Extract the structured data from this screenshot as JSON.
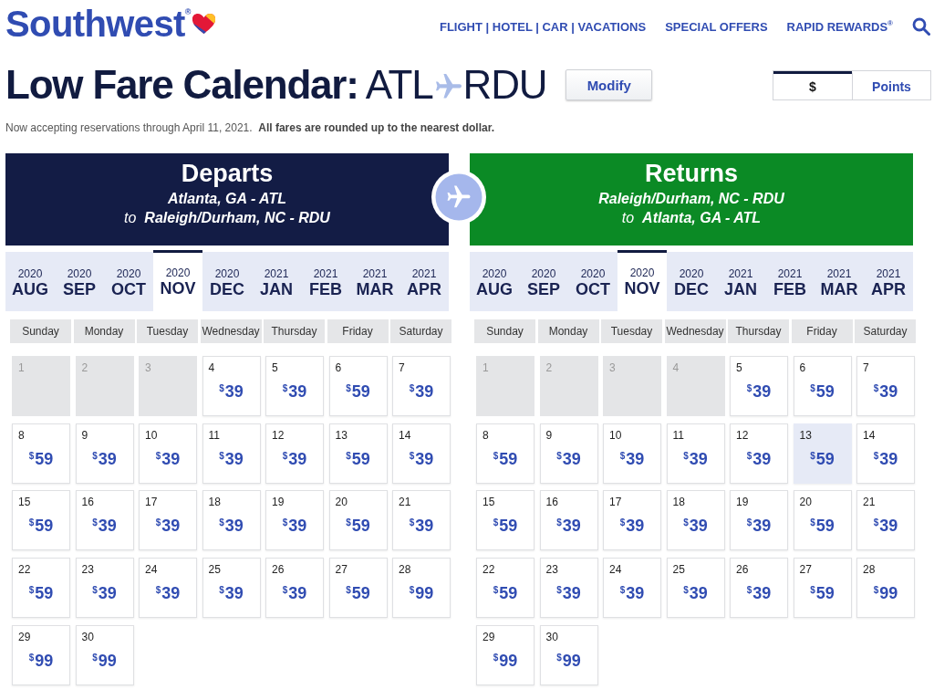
{
  "header": {
    "logo": "Southwest$^{®}$",
    "nav_links": [
      "FLIGHT | HOTEL | CAR | VACATIONS",
      "SPECIAL OFFERS",
      "RAPID REWARDS$^{®}$"
    ]
  },
  "title": {
    "label": "Low Fare Calendar:",
    "origin": "ATL",
    "destination": "RDU"
  },
  "modify_button": "Modify",
  "currency_toggle": [
    {
      "label": "$",
      "selected": true
    },
    {
      "label": "Points",
      "selected": false
    }
  ],
  "note": "Now accepting reservations through April 11, 2021.  **All fares are rounded up to the nearest dollar.**",
  "calendars": [
    {
      "title": "Departs",
      "color": "#131c45",
      "route_from": "Atlanta, GA - ATL",
      "route_to": "to  **Raleigh/Durham, NC - RDU**",
      "months": [
        {
          "year": "2020",
          "month": "AUG",
          "selected": false
        },
        {
          "year": "2020",
          "month": "SEP",
          "selected": false
        },
        {
          "year": "2020",
          "month": "OCT",
          "selected": false
        },
        {
          "year": "2020",
          "month": "NOV",
          "selected": true
        },
        {
          "year": "2020",
          "month": "DEC",
          "selected": false
        },
        {
          "year": "2021",
          "month": "JAN",
          "selected": false
        },
        {
          "year": "2021",
          "month": "FEB",
          "selected": false
        },
        {
          "year": "2021",
          "month": "MAR",
          "selected": false
        },
        {
          "year": "2021",
          "month": "APR",
          "selected": false
        }
      ],
      "weekdays": [
        "Sunday",
        "Monday",
        "Tuesday",
        "Wednesday",
        "Thursday",
        "Friday",
        "Saturday"
      ],
      "days": [
        {
          "day": "1",
          "disabled": true,
          "selected": false
        },
        {
          "day": "2",
          "disabled": true,
          "selected": false
        },
        {
          "day": "3",
          "disabled": true,
          "selected": false
        },
        {
          "day": "4",
          "disabled": false,
          "selected": false,
          "currency": "$",
          "fare": "39"
        },
        {
          "day": "5",
          "disabled": false,
          "selected": false,
          "currency": "$",
          "fare": "39"
        },
        {
          "day": "6",
          "disabled": false,
          "selected": false,
          "currency": "$",
          "fare": "59"
        },
        {
          "day": "7",
          "disabled": false,
          "selected": false,
          "currency": "$",
          "fare": "39"
        },
        {
          "day": "8",
          "disabled": false,
          "selected": false,
          "currency": "$",
          "fare": "59"
        },
        {
          "day": "9",
          "disabled": false,
          "selected": false,
          "currency": "$",
          "fare": "39"
        },
        {
          "day": "10",
          "disabled": false,
          "selected": false,
          "currency": "$",
          "fare": "39"
        },
        {
          "day": "11",
          "disabled": false,
          "selected": false,
          "currency": "$",
          "fare": "39"
        },
        {
          "day": "12",
          "disabled": false,
          "selected": false,
          "currency": "$",
          "fare": "39"
        },
        {
          "day": "13",
          "disabled": false,
          "selected": false,
          "currency": "$",
          "fare": "59"
        },
        {
          "day": "14",
          "disabled": false,
          "selected": false,
          "currency": "$",
          "fare": "39"
        },
        {
          "day": "15",
          "disabled": false,
          "selected": false,
          "currency": "$",
          "fare": "59"
        },
        {
          "day": "16",
          "disabled": false,
          "selected": false,
          "currency": "$",
          "fare": "39"
        },
        {
          "day": "17",
          "disabled": false,
          "selected": false,
          "currency": "$",
          "fare": "39"
        },
        {
          "day": "18",
          "disabled": false,
          "selected": false,
          "currency": "$",
          "fare": "39"
        },
        {
          "day": "19",
          "disabled": false,
          "selected": false,
          "currency": "$",
          "fare": "39"
        },
        {
          "day": "20",
          "disabled": false,
          "selected": false,
          "currency": "$",
          "fare": "59"
        },
        {
          "day": "21",
          "disabled": false,
          "selected": false,
          "currency": "$",
          "fare": "39"
        },
        {
          "day": "22",
          "disabled": false,
          "selected": false,
          "currency": "$",
          "fare": "59"
        },
        {
          "day": "23",
          "disabled": false,
          "selected": false,
          "currency": "$",
          "fare": "39"
        },
        {
          "day": "24",
          "disabled": false,
          "selected": false,
          "currency": "$",
          "fare": "39"
        },
        {
          "day": "25",
          "disabled": false,
          "selected": false,
          "currency": "$",
          "fare": "39"
        },
        {
          "day": "26",
          "disabled": false,
          "selected": false,
          "currency": "$",
          "fare": "39"
        },
        {
          "day": "27",
          "disabled": false,
          "selected": false,
          "currency": "$",
          "fare": "59"
        },
        {
          "day": "28",
          "disabled": false,
          "selected": false,
          "currency": "$",
          "fare": "99"
        },
        {
          "day": "29",
          "disabled": false,
          "selected": false,
          "currency": "$",
          "fare": "99"
        },
        {
          "day": "30",
          "disabled": false,
          "selected": false,
          "currency": "$",
          "fare": "99"
        }
      ]
    },
    {
      "title": "Returns",
      "color": "#0b8a25",
      "route_from": "Raleigh/Durham, NC - RDU",
      "route_to": "to  **Atlanta, GA - ATL**",
      "months": [
        {
          "year": "2020",
          "month": "AUG",
          "selected": false
        },
        {
          "year": "2020",
          "month": "SEP",
          "selected": false
        },
        {
          "year": "2020",
          "month": "OCT",
          "selected": false
        },
        {
          "year": "2020",
          "month": "NOV",
          "selected": true
        },
        {
          "year": "2020",
          "month": "DEC",
          "selected": false
        },
        {
          "year": "2021",
          "month": "JAN",
          "selected": false
        },
        {
          "year": "2021",
          "month": "FEB",
          "selected": false
        },
        {
          "year": "2021",
          "month": "MAR",
          "selected": false
        },
        {
          "year": "2021",
          "month": "APR",
          "selected": false
        }
      ],
      "weekdays": [
        "Sunday",
        "Monday",
        "Tuesday",
        "Wednesday",
        "Thursday",
        "Friday",
        "Saturday"
      ],
      "days": [
        {
          "day": "1",
          "disabled": true,
          "selected": false
        },
        {
          "day": "2",
          "disabled": true,
          "selected": false
        },
        {
          "day": "3",
          "disabled": true,
          "selected": false
        },
        {
          "day": "4",
          "disabled": true,
          "selected": false
        },
        {
          "day": "5",
          "disabled": false,
          "selected": false,
          "currency": "$",
          "fare": "39"
        },
        {
          "day": "6",
          "disabled": false,
          "selected": false,
          "currency": "$",
          "fare": "59"
        },
        {
          "day": "7",
          "disabled": false,
          "selected": false,
          "currency": "$",
          "fare": "39"
        },
        {
          "day": "8",
          "disabled": false,
          "selected": false,
          "currency": "$",
          "fare": "59"
        },
        {
          "day": "9",
          "disabled": false,
          "selected": false,
          "currency": "$",
          "fare": "39"
        },
        {
          "day": "10",
          "disabled": false,
          "selected": false,
          "currency": "$",
          "fare": "39"
        },
        {
          "day": "11",
          "disabled": false,
          "selected": false,
          "currency": "$",
          "fare": "39"
        },
        {
          "day": "12",
          "disabled": false,
          "selected": false,
          "currency": "$",
          "fare": "39"
        },
        {
          "day": "13",
          "disabled": false,
          "selected": true,
          "currency": "$",
          "fare": "59"
        },
        {
          "day": "14",
          "disabled": false,
          "selected": false,
          "currency": "$",
          "fare": "39"
        },
        {
          "day": "15",
          "disabled": false,
          "selected": false,
          "currency": "$",
          "fare": "59"
        },
        {
          "day": "16",
          "disabled": false,
          "selected": false,
          "currency": "$",
          "fare": "39"
        },
        {
          "day": "17",
          "disabled": false,
          "selected": false,
          "currency": "$",
          "fare": "39"
        },
        {
          "day": "18",
          "disabled": false,
          "selected": false,
          "currency": "$",
          "fare": "39"
        },
        {
          "day": "19",
          "disabled": false,
          "selected": false,
          "currency": "$",
          "fare": "39"
        },
        {
          "day": "20",
          "disabled": false,
          "selected": false,
          "currency": "$",
          "fare": "59"
        },
        {
          "day": "21",
          "disabled": false,
          "selected": false,
          "currency": "$",
          "fare": "39"
        },
        {
          "day": "22",
          "disabled": false,
          "selected": false,
          "currency": "$",
          "fare": "59"
        },
        {
          "day": "23",
          "disabled": false,
          "selected": false,
          "currency": "$",
          "fare": "39"
        },
        {
          "day": "24",
          "disabled": false,
          "selected": false,
          "currency": "$",
          "fare": "39"
        },
        {
          "day": "25",
          "disabled": false,
          "selected": false,
          "currency": "$",
          "fare": "39"
        },
        {
          "day": "26",
          "disabled": false,
          "selected": false,
          "currency": "$",
          "fare": "39"
        },
        {
          "day": "27",
          "disabled": false,
          "selected": false,
          "currency": "$",
          "fare": "59"
        },
        {
          "day": "28",
          "disabled": false,
          "selected": false,
          "currency": "$",
          "fare": "99"
        },
        {
          "day": "29",
          "disabled": false,
          "selected": false,
          "currency": "$",
          "fare": "99"
        },
        {
          "day": "30",
          "disabled": false,
          "selected": false,
          "currency": "$",
          "fare": "99"
        }
      ]
    }
  ]
}
